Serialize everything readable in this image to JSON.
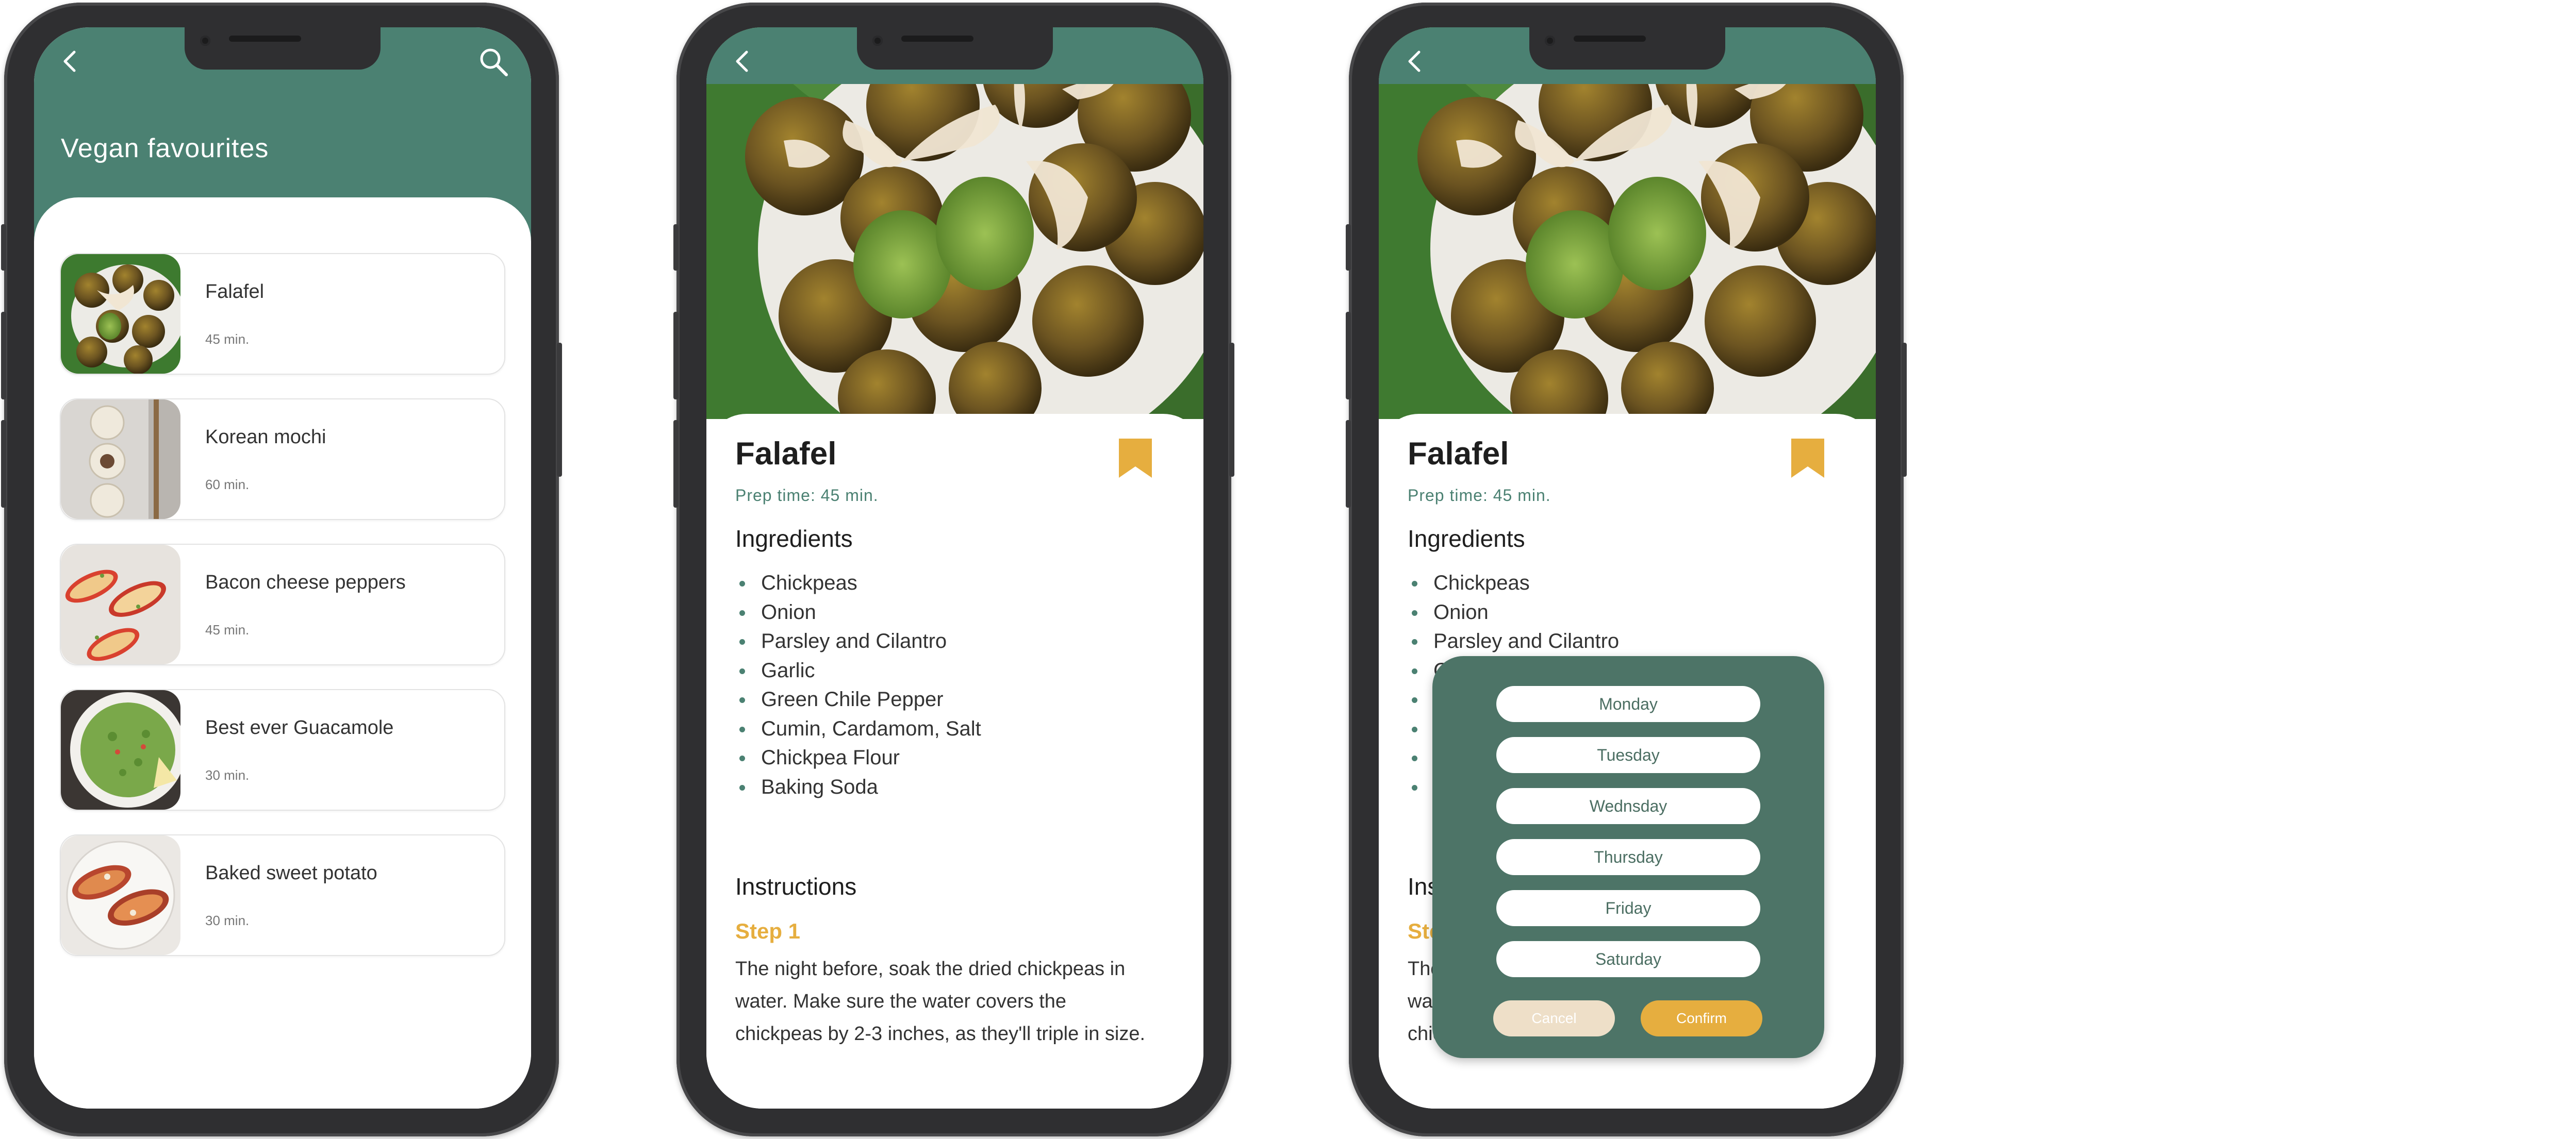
{
  "screen1": {
    "title": "Vegan favourites",
    "recipes": [
      {
        "name": "Falafel",
        "time": "45 min."
      },
      {
        "name": "Korean mochi",
        "time": "60 min."
      },
      {
        "name": "Bacon cheese peppers",
        "time": "45 min."
      },
      {
        "name": "Best ever Guacamole",
        "time": "30 min."
      },
      {
        "name": "Baked sweet potato",
        "time": "30 min."
      }
    ]
  },
  "detail": {
    "title": "Falafel",
    "prep": "Prep time: 45 min.",
    "ingredients_heading": "Ingredients",
    "ingredients": [
      "Chickpeas",
      "Onion",
      "Parsley and Cilantro",
      "Garlic",
      "Green Chile Pepper",
      "Cumin, Cardamom, Salt",
      "Chickpea Flour",
      "Baking Soda"
    ],
    "instructions_heading": "Instructions",
    "step_label": "Step 1",
    "step_text": "The night before, soak the dried chickpeas in water. Make sure the water covers the chickpeas by 2-3 inches, as they'll triple in size."
  },
  "modal": {
    "days": [
      "Monday",
      "Tuesday",
      "Wednsday",
      "Thursday",
      "Friday",
      "Saturday"
    ],
    "cancel": "Cancel",
    "confirm": "Confirm"
  },
  "icons": {
    "back": "chevron-left-icon",
    "search": "search-icon",
    "bookmark": "bookmark-icon"
  },
  "colors": {
    "primary": "#4b8172",
    "accent": "#e6ae3f",
    "modal": "#4d7467"
  }
}
